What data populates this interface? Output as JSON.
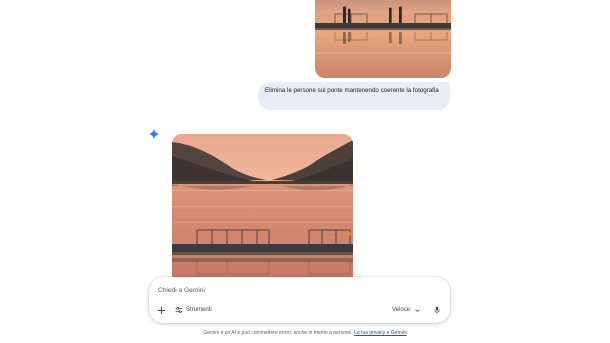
{
  "conversation": {
    "user_message": "Elimina le persone sul ponte mantenendo coerente la fotografia",
    "previous_image_icon": "lake-sunset-photo-with-people",
    "generated_image_icon": "lake-sunset-photo-empty-pier",
    "assistant_icon": "gemini-spark-icon"
  },
  "composer": {
    "placeholder": "Chiedi a Gemini",
    "value": "",
    "add_icon": "plus-icon",
    "tools_label": "Strumenti",
    "tools_icon": "tools-sliders-icon",
    "model_label": "Veloce",
    "model_icon": "chevron-down-icon",
    "mic_icon": "microphone-icon"
  },
  "footer": {
    "disclaimer_text": "Gemini è un'AI e può commettere errori, anche in merito a persone.",
    "link_text": "La tua privacy e Gemini"
  },
  "colors": {
    "accent_blue": "#0b57d0",
    "bubble": "#e9eef6",
    "spark_blue": "#4285f4"
  }
}
